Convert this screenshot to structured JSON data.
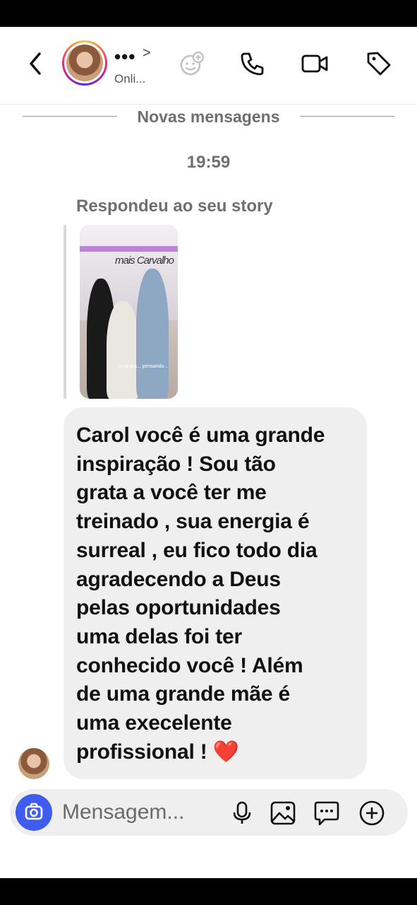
{
  "header": {
    "contact_name": "•••",
    "status": "Onli...",
    "chevron": ">"
  },
  "icons": {
    "back": "chevron-left-icon",
    "add_emoji": "emoji-add-icon",
    "call": "phone-icon",
    "video": "video-camera-icon",
    "tag": "tag-icon",
    "camera": "camera-icon",
    "mic": "microphone-icon",
    "gallery": "image-icon",
    "sticker": "chat-bubble-icon",
    "add": "plus-circle-icon"
  },
  "conversation": {
    "new_messages_label": "Novas mensagens",
    "timestamp": "19:59",
    "reply_context": "Respondeu ao seu story",
    "story_sign": "mais Carvalho",
    "story_caption": "Uma pra... pensando...",
    "message_text": "Carol você é uma grande\ninspiração ! Sou tão\ngrata a você ter me\ntreinado , sua energia é\nsurreal , eu fico todo dia\nagradecendo a Deus\npelas oportunidades\numa delas foi ter\nconhecido você ! Além\nde uma grande mãe é\numa execelente\nprofissional !",
    "message_emoji": "❤️"
  },
  "composer": {
    "placeholder": "Mensagem..."
  },
  "colors": {
    "accent": "#3f5cf0",
    "bubble": "#efefef",
    "muted_text": "#6f6f6f",
    "heart": "#d4102a"
  }
}
